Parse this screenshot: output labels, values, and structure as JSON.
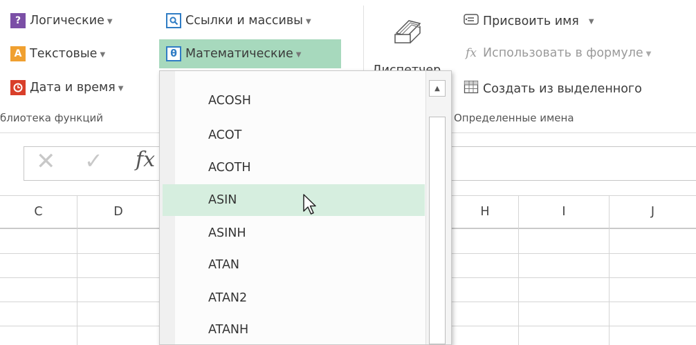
{
  "ribbon": {
    "logical": "Логические",
    "text": "Текстовые",
    "datetime": "Дата и время",
    "lookup": "Ссылки и массивы",
    "math": "Математические",
    "dispatcher": "Диспетчер",
    "assign_name": "Присвоить имя",
    "use_in_formula": "Использовать в формуле",
    "create_from_selection": "Создать из выделенного",
    "group_library": "блиотека функций",
    "group_names": "Определенные имена"
  },
  "icons": {
    "logical": "?",
    "text": "A",
    "math": "θ",
    "fx": "fx"
  },
  "columns": [
    "C",
    "D",
    "H",
    "I",
    "J"
  ],
  "dropdown": {
    "items": [
      "ACOSH",
      "ACOT",
      "ACOTH",
      "ASIN",
      "ASINH",
      "ATAN",
      "ATAN2",
      "ATANH"
    ],
    "highlighted": "ASIN"
  },
  "colors": {
    "accent_green": "#a7d9bd",
    "highlight": "#d6eedf",
    "logical_icon": "#7b4fa6",
    "text_icon": "#f0a030",
    "datetime_icon": "#d93f2a",
    "lookup_icon": "#2f7cc4"
  }
}
